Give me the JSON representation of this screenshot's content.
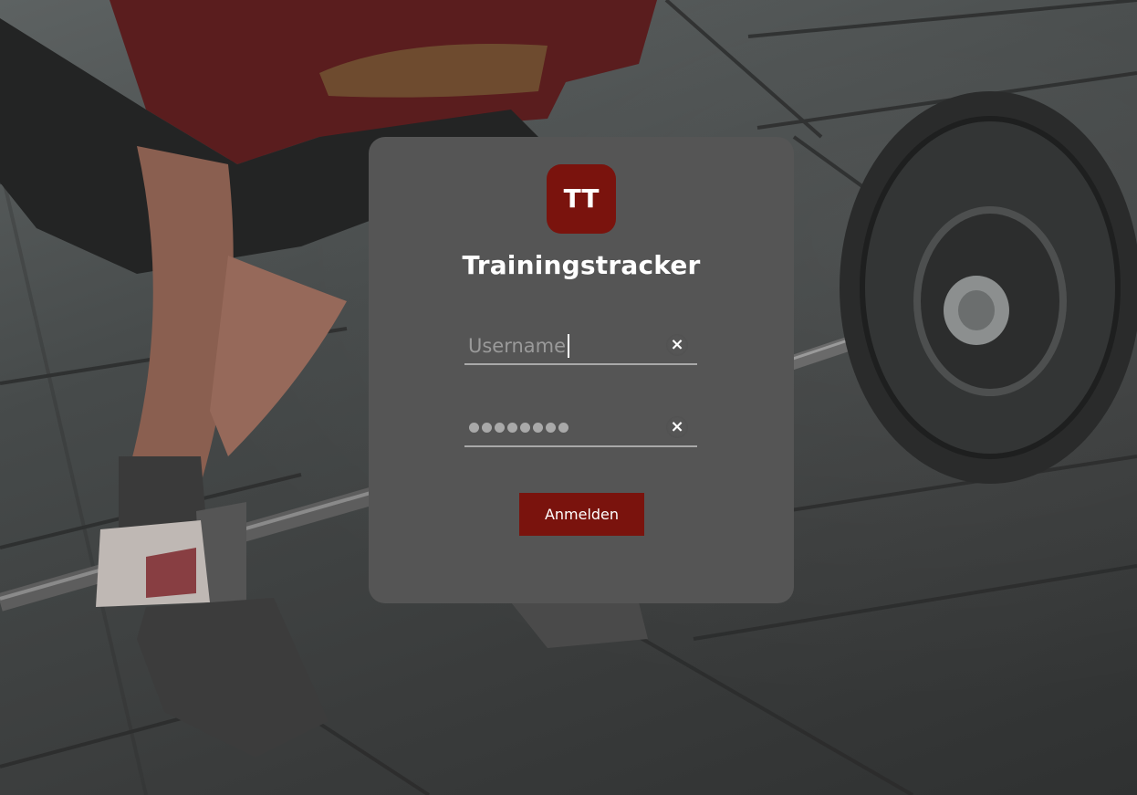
{
  "app": {
    "logo_text": "TT",
    "title": "Trainingstracker"
  },
  "form": {
    "username_placeholder": "Username",
    "username_value": "",
    "password_masked_length": 8,
    "clear_icon": "×",
    "submit_label": "Anmelden"
  },
  "colors": {
    "accent": "#7a130d",
    "card": "#555555",
    "text": "#ffffff"
  },
  "icons": {
    "clear": "close-icon"
  }
}
